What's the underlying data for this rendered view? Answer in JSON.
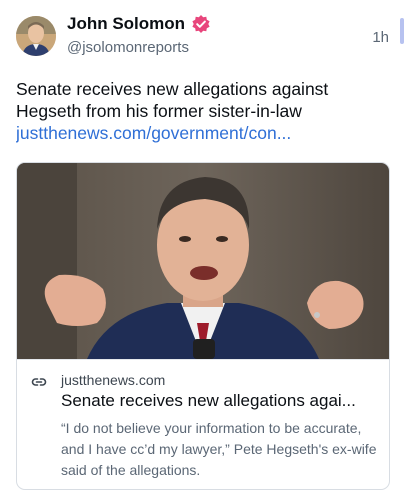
{
  "author": {
    "display_name": "John Solomon",
    "handle": "@jsolomonreports",
    "verified_icon": "verified-badge-icon",
    "badge_color": "#e8467c"
  },
  "timestamp": "1h",
  "post": {
    "text": "Senate receives new allegations against Hegseth from his former sister-in-law",
    "link": "justthenews.com/government/con..."
  },
  "card": {
    "link_icon": "link-icon",
    "domain": "justthenews.com",
    "title": "Senate receives new allegations agai...",
    "description": "“I do not believe your information to be accurate, and I have cc’d my lawyer,” Pete Hegseth's ex-wife said of the allegations."
  },
  "colors": {
    "link": "#2f6fd6",
    "muted": "#5b6775",
    "text": "#0b0f14",
    "border": "#d8dde3"
  }
}
